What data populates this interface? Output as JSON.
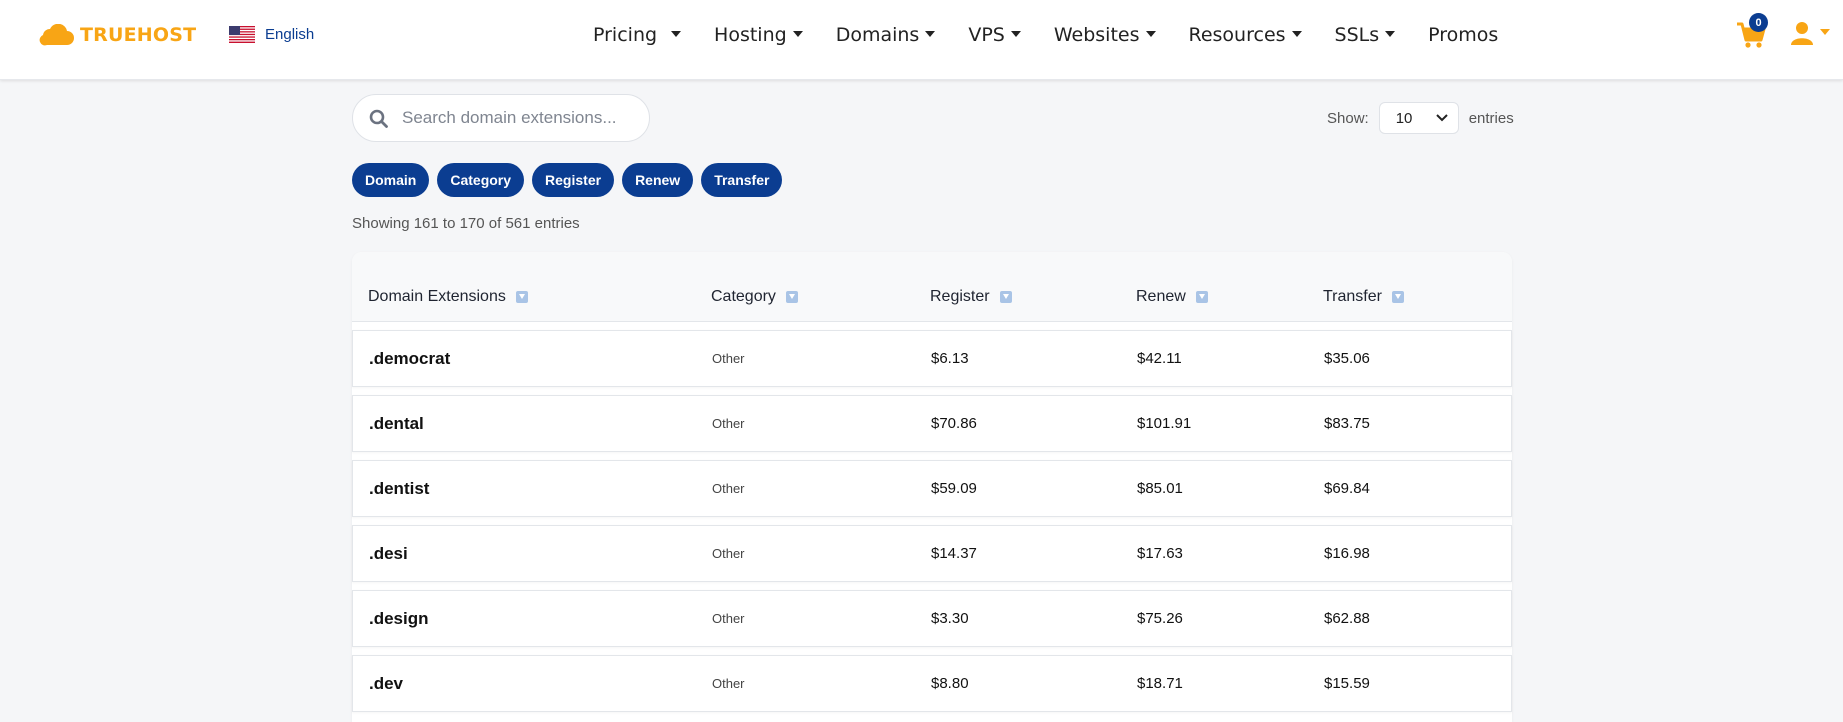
{
  "header": {
    "brand": "TRUEHOST",
    "language": "English",
    "nav": [
      {
        "label": "Pricing",
        "has_dropdown": true
      },
      {
        "label": "Hosting",
        "has_dropdown": true
      },
      {
        "label": "Domains",
        "has_dropdown": true
      },
      {
        "label": "VPS",
        "has_dropdown": true
      },
      {
        "label": "Websites",
        "has_dropdown": true
      },
      {
        "label": "Resources",
        "has_dropdown": true
      },
      {
        "label": "SSLs",
        "has_dropdown": true
      },
      {
        "label": "Promos",
        "has_dropdown": false
      }
    ],
    "cart_count": "0"
  },
  "controls": {
    "search_placeholder": "Search domain extensions...",
    "show_label": "Show:",
    "entries_value": "10",
    "entries_label": "entries",
    "filters": [
      "Domain",
      "Category",
      "Register",
      "Renew",
      "Transfer"
    ],
    "summary": "Showing 161 to 170 of 561 entries"
  },
  "table": {
    "columns": [
      "Domain Extensions",
      "Category",
      "Register",
      "Renew",
      "Transfer"
    ],
    "rows": [
      {
        "domain": ".democrat",
        "category": "Other",
        "register": "$6.13",
        "renew": "$42.11",
        "transfer": "$35.06"
      },
      {
        "domain": ".dental",
        "category": "Other",
        "register": "$70.86",
        "renew": "$101.91",
        "transfer": "$83.75"
      },
      {
        "domain": ".dentist",
        "category": "Other",
        "register": "$59.09",
        "renew": "$85.01",
        "transfer": "$69.84"
      },
      {
        "domain": ".desi",
        "category": "Other",
        "register": "$14.37",
        "renew": "$17.63",
        "transfer": "$16.98"
      },
      {
        "domain": ".design",
        "category": "Other",
        "register": "$3.30",
        "renew": "$75.26",
        "transfer": "$62.88"
      },
      {
        "domain": ".dev",
        "category": "Other",
        "register": "$8.80",
        "renew": "$18.71",
        "transfer": "$15.59"
      }
    ]
  },
  "colors": {
    "brand": "#f8a515",
    "primary": "#0b3d91",
    "page_bg": "#f5f6f8"
  }
}
